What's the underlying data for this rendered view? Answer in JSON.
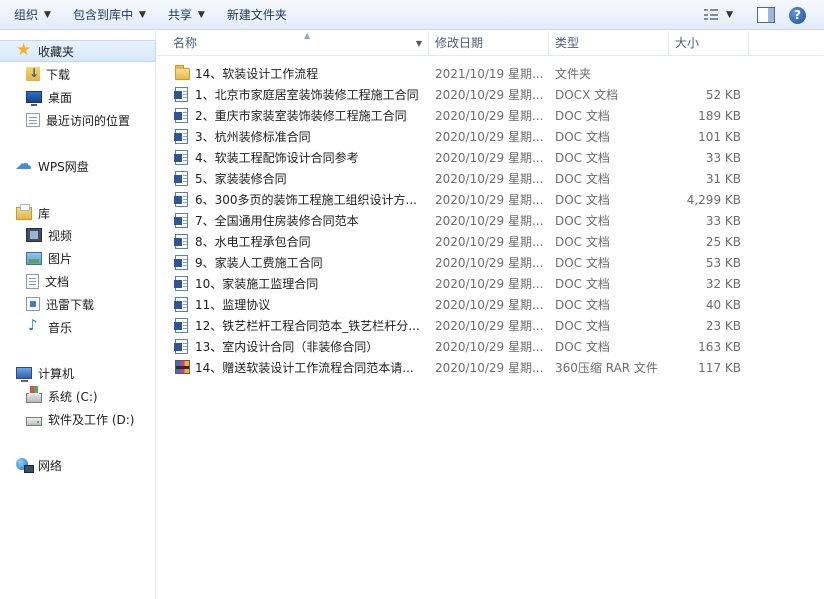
{
  "toolbar": {
    "organize": "组织",
    "include_library": "包含到库中",
    "share": "共享",
    "new_folder": "新建文件夹",
    "help": "?"
  },
  "nav": {
    "favorites": {
      "title": "收藏夹",
      "items": [
        {
          "label": "下载",
          "icon": "download-folder-icon"
        },
        {
          "label": "桌面",
          "icon": "desktop-icon"
        },
        {
          "label": "最近访问的位置",
          "icon": "recent-places-icon"
        }
      ]
    },
    "wps": {
      "title": "WPS网盘",
      "icon": "cloud-icon"
    },
    "libraries": {
      "title": "库",
      "items": [
        {
          "label": "视频",
          "icon": "video-library-icon"
        },
        {
          "label": "图片",
          "icon": "picture-library-icon"
        },
        {
          "label": "文档",
          "icon": "document-library-icon"
        },
        {
          "label": "迅雷下载",
          "icon": "xunlei-download-icon"
        },
        {
          "label": "音乐",
          "icon": "music-library-icon"
        }
      ]
    },
    "computer": {
      "title": "计算机",
      "items": [
        {
          "label": "系统 (C:)",
          "icon": "system-drive-icon"
        },
        {
          "label": "软件及工作 (D:)",
          "icon": "drive-icon"
        }
      ]
    },
    "network": {
      "title": "网络",
      "icon": "network-icon"
    }
  },
  "columns": {
    "name": "名称",
    "date": "修改日期",
    "type": "类型",
    "size": "大小"
  },
  "files": [
    {
      "name": "14、软装设计工作流程",
      "date": "2021/10/19 星期...",
      "type": "文件夹",
      "size": "",
      "icon": "folder"
    },
    {
      "name": "1、北京市家庭居室装饰装修工程施工合同",
      "date": "2020/10/29 星期...",
      "type": "DOCX 文档",
      "size": "52 KB",
      "icon": "word"
    },
    {
      "name": "2、重庆市家装室装饰装修工程施工合同",
      "date": "2020/10/29 星期...",
      "type": "DOC 文档",
      "size": "189 KB",
      "icon": "word"
    },
    {
      "name": "3、杭州装修标准合同",
      "date": "2020/10/29 星期...",
      "type": "DOC 文档",
      "size": "101 KB",
      "icon": "word"
    },
    {
      "name": "4、软装工程配饰设计合同参考",
      "date": "2020/10/29 星期...",
      "type": "DOC 文档",
      "size": "33 KB",
      "icon": "word"
    },
    {
      "name": "5、家装装修合同",
      "date": "2020/10/29 星期...",
      "type": "DOC 文档",
      "size": "31 KB",
      "icon": "word"
    },
    {
      "name": "6、300多页的装饰工程施工组织设计方...",
      "date": "2020/10/29 星期...",
      "type": "DOC 文档",
      "size": "4,299 KB",
      "icon": "word"
    },
    {
      "name": "7、全国通用住房装修合同范本",
      "date": "2020/10/29 星期...",
      "type": "DOC 文档",
      "size": "33 KB",
      "icon": "word"
    },
    {
      "name": "8、水电工程承包合同",
      "date": "2020/10/29 星期...",
      "type": "DOC 文档",
      "size": "25 KB",
      "icon": "word"
    },
    {
      "name": "9、家装人工费施工合同",
      "date": "2020/10/29 星期...",
      "type": "DOC 文档",
      "size": "53 KB",
      "icon": "word"
    },
    {
      "name": "10、家装施工监理合同",
      "date": "2020/10/29 星期...",
      "type": "DOC 文档",
      "size": "32 KB",
      "icon": "word"
    },
    {
      "name": "11、监理协议",
      "date": "2020/10/29 星期...",
      "type": "DOC 文档",
      "size": "40 KB",
      "icon": "word"
    },
    {
      "name": "12、铁艺栏杆工程合同范本_铁艺栏杆分...",
      "date": "2020/10/29 星期...",
      "type": "DOC 文档",
      "size": "23 KB",
      "icon": "word"
    },
    {
      "name": "13、室内设计合同（非装修合同）",
      "date": "2020/10/29 星期...",
      "type": "DOC 文档",
      "size": "163 KB",
      "icon": "word"
    },
    {
      "name": "14、赠送软装设计工作流程合同范本请...",
      "date": "2020/10/29 星期...",
      "type": "360压缩 RAR 文件",
      "size": "117 KB",
      "icon": "rar"
    }
  ]
}
